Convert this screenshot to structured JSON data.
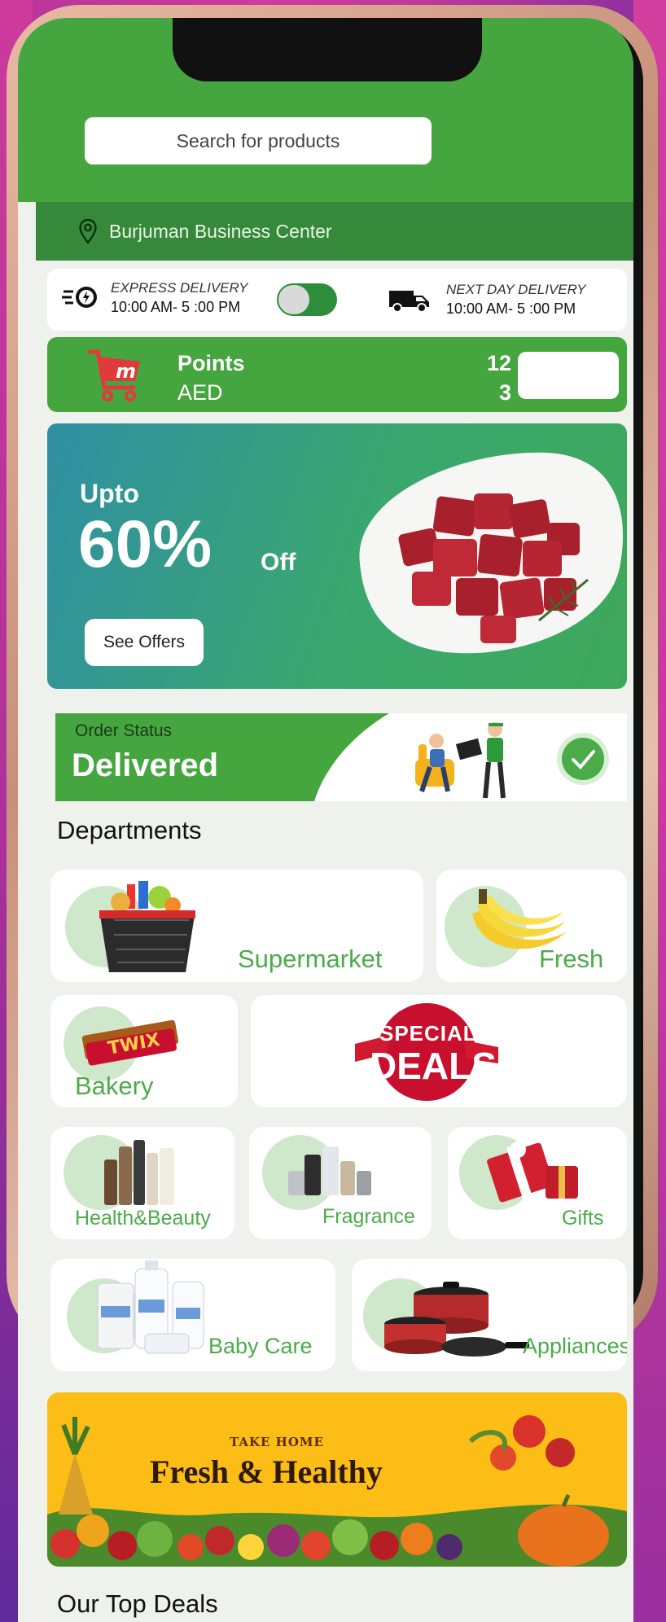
{
  "search": {
    "placeholder": "Search for products"
  },
  "location": {
    "name": "Burjuman Business Center",
    "icon": "map-pin-icon"
  },
  "delivery": {
    "express": {
      "label": "EXPRESS DELIVERY",
      "time": "10:00 AM- 5 :00 PM",
      "icon": "fast-delivery-icon"
    },
    "next_day": {
      "label": "NEXT DAY DELIVERY",
      "time": "10:00 AM- 5 :00 PM",
      "icon": "delivery-truck-icon"
    }
  },
  "points": {
    "points_label": "Points",
    "aed_label": "AED",
    "points_value": "12",
    "aed_value": "3",
    "icon": "cart-logo-icon"
  },
  "promo": {
    "upto": "Upto",
    "percent": "60%",
    "off": "Off",
    "button": "See Offers"
  },
  "order": {
    "label": "Order Status",
    "status": "Delivered"
  },
  "departments": {
    "title": "Departments",
    "items": {
      "supermarket": "Supermarket",
      "fresh": "Fresh",
      "bakery": "Bakery",
      "special_line1": "SPECIAL",
      "special_line2": "DEALS",
      "health": "Health&Beauty",
      "fragrance": "Fragrance",
      "gifts": "Gifts",
      "baby": "Baby Care",
      "appliances": "Appliances"
    }
  },
  "banner": {
    "take_home": "TAKE HOME",
    "headline": "Fresh & Healthy"
  },
  "top_deals": {
    "title": "Our Top Deals"
  },
  "colors": {
    "brand_green": "#45a63f",
    "dark_green": "#36893a",
    "label_green": "#4bab49",
    "banner_yellow": "#fbbd16"
  }
}
